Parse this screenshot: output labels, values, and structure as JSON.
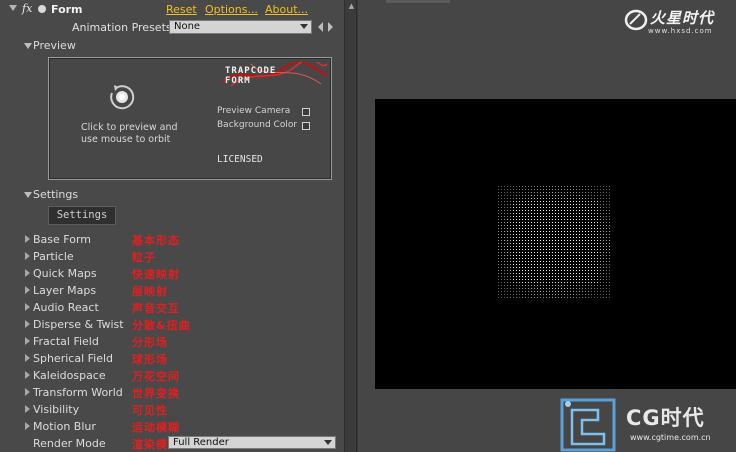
{
  "effect": {
    "title": "Form",
    "fx_label": "fx",
    "links": {
      "reset": "Reset",
      "options": "Options...",
      "about": "About..."
    },
    "presets_label": "Animation Presets:",
    "presets_value": "None"
  },
  "preview": {
    "label": "Preview",
    "instruction_line1": "Click to preview and",
    "instruction_line2": "use mouse to orbit",
    "logo_line1": "TRAPCODE",
    "logo_line2": "FORM",
    "option1": "Preview Camera",
    "option2": "Background Color",
    "license": "LICENSED"
  },
  "settings": {
    "label": "Settings",
    "button": "Settings"
  },
  "groups": [
    {
      "label": "Base Form",
      "cn": "基本形态"
    },
    {
      "label": "Particle",
      "cn": "粒子"
    },
    {
      "label": "Quick Maps",
      "cn": "快速映射"
    },
    {
      "label": "Layer Maps",
      "cn": "层映射"
    },
    {
      "label": "Audio React",
      "cn": "声音交互"
    },
    {
      "label": "Disperse & Twist",
      "cn": "分散&扭曲"
    },
    {
      "label": "Fractal Field",
      "cn": "分形场"
    },
    {
      "label": "Spherical Field",
      "cn": "球形场"
    },
    {
      "label": "Kaleidospace",
      "cn": "万花空间"
    },
    {
      "label": "Transform World",
      "cn": "世界变换"
    },
    {
      "label": "Visibility",
      "cn": "可见性"
    },
    {
      "label": "Motion Blur",
      "cn": "运动模糊"
    }
  ],
  "render_mode": {
    "label": "Render Mode",
    "cn": "渲染模式",
    "value": "Full Render"
  },
  "watermarks": {
    "top_title": "火星时代",
    "top_url": "www.hxsd.com",
    "bottom_title": "CG时代",
    "bottom_url": "www.cgtime.com.cn"
  },
  "colors": {
    "panel_bg": "#494949",
    "link": "#f0c020",
    "annotation_red": "#e02020",
    "canvas_bg": "#000000"
  },
  "icons": [
    "fx-icon",
    "orbit-icon",
    "twirl-triangle-icon",
    "dropdown-arrow-icon",
    "trapcode-logo-icon"
  ]
}
